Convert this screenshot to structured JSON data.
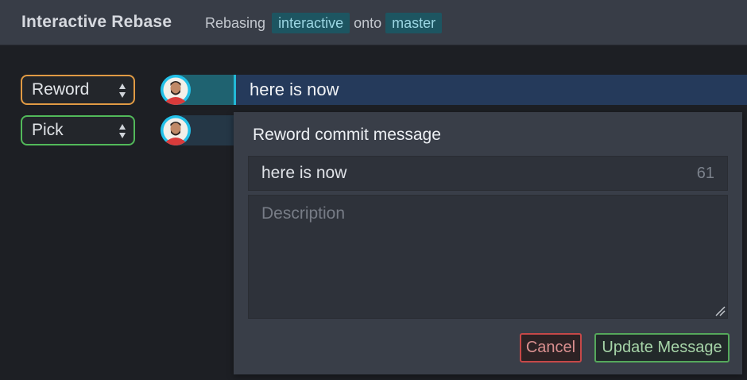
{
  "header": {
    "title": "Interactive Rebase",
    "rebasing_label": "Rebasing",
    "source_branch": "interactive",
    "onto_label": "onto",
    "target_branch": "master"
  },
  "commits": [
    {
      "action": "Reword",
      "action_color": "#e09a44",
      "message": "here is now",
      "avatar_bar_color": "#1f6270"
    },
    {
      "action": "Pick",
      "action_color": "#52b95a",
      "message": "",
      "avatar_bar_color": "#253746"
    }
  ],
  "reword_panel": {
    "title": "Reword commit message",
    "summary_value": "here is now",
    "summary_char_count": "61",
    "description_placeholder": "Description",
    "cancel_label": "Cancel",
    "update_label": "Update Message"
  },
  "colors": {
    "accent": "#23b9d7",
    "cancel": "#c64848",
    "update": "#55a85b"
  },
  "icons": {
    "select_arrows": "updown-arrows-icon",
    "avatar": "user-avatar-icon",
    "resize": "resize-grip-icon"
  }
}
